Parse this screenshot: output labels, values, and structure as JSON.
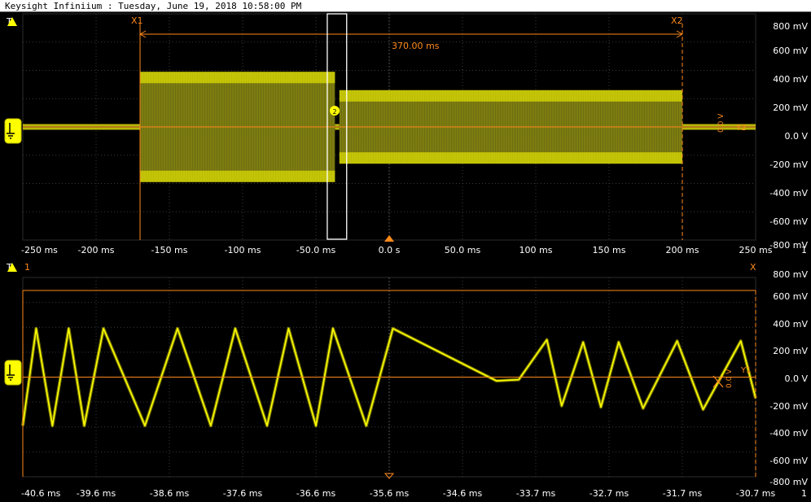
{
  "window": {
    "title": "Keysight Infiniium : Tuesday, June 19, 2018 10:58:00 PM"
  },
  "colors": {
    "trace": "#ffff00",
    "marker": "#ff8a1a",
    "grid": "#3a3a3a",
    "axis_text": "#ffffff",
    "background": "#000000"
  },
  "upper_panel": {
    "corner_label": "T",
    "marker_x1_label": "X1",
    "marker_x2_label": "X2",
    "delta_label": "370.00 ms",
    "channel_badge": "2",
    "y2_label": "Y2",
    "y_marker_value": "0.0 V",
    "y_tick_labels": [
      "800 mV",
      "600 mV",
      "400 mV",
      "200 mV",
      "0.0 V",
      "-200 mV",
      "-400 mV",
      "-600 mV",
      "-800 mV"
    ],
    "x_tick_labels": [
      "-250 ms",
      "-200 ms",
      "-150 ms",
      "-100 ms",
      "-50.0 ms",
      "0.0 s",
      "50.0 ms",
      "100 ms",
      "150 ms",
      "200 ms",
      "250 ms"
    ],
    "page_indicator": "1",
    "channel_icon": "ground-reference-icon",
    "trigger_icon": "trigger-arrow-icon"
  },
  "lower_panel": {
    "corner_label": "T",
    "marker_x1_label": "1",
    "marker_x_label": "X",
    "y1_label": "Y1",
    "y_marker_value": "0.0 V",
    "y_tick_labels": [
      "800 mV",
      "600 mV",
      "400 mV",
      "200 mV",
      "0.0 V",
      "-200 mV",
      "-400 mV",
      "-600 mV",
      "-800 mV"
    ],
    "x_tick_labels": [
      "-40.6 ms",
      "-39.6 ms",
      "-38.6 ms",
      "-37.6 ms",
      "-36.6 ms",
      "-35.6 ms",
      "-34.6 ms",
      "-33.7 ms",
      "-32.7 ms",
      "-31.7 ms",
      "-30.7 ms"
    ],
    "page_indicator": "1",
    "channel_icon": "ground-reference-icon",
    "trigger_icon": "trigger-arrow-icon"
  },
  "chart_data": [
    {
      "type": "line",
      "title": "",
      "xlabel": "",
      "ylabel": "",
      "x_range_ms": [
        -250,
        250
      ],
      "ylim_mV": [
        -800,
        800
      ],
      "grid": true,
      "cursor_x1_ms": -170,
      "cursor_x2_ms": 200,
      "cursor_delta_ms": 370,
      "zoom_window_ms": [
        -40.6,
        -30.7
      ],
      "series": [
        {
          "segments": [
            {
              "x_start_ms": -250,
              "x_end_ms": -170,
              "amplitude_mV": 20
            },
            {
              "x_start_ms": -170,
              "x_end_ms": -37,
              "amplitude_mV": 390
            },
            {
              "x_start_ms": -37,
              "x_end_ms": -34,
              "amplitude_mV": 20
            },
            {
              "x_start_ms": -34,
              "x_end_ms": 200,
              "amplitude_mV": 260
            },
            {
              "x_start_ms": 200,
              "x_end_ms": 250,
              "amplitude_mV": 20
            }
          ]
        }
      ]
    },
    {
      "type": "line",
      "title": "",
      "xlabel": "",
      "ylabel": "",
      "x_range_ms": [
        -40.6,
        -30.7
      ],
      "ylim_mV": [
        -800,
        800
      ],
      "grid": true,
      "series": [
        {
          "x": [
            -40.6,
            -40.42,
            -40.2,
            -39.98,
            -39.77,
            -39.51,
            -38.95,
            -38.51,
            -38.06,
            -37.73,
            -37.3,
            -37.01,
            -36.64,
            -36.41,
            -35.96,
            -35.6,
            -34.2,
            -33.9,
            -33.52,
            -33.32,
            -33.03,
            -32.79,
            -32.55,
            -32.22,
            -31.76,
            -31.41,
            -30.9,
            -30.7
          ],
          "y": [
            -390,
            390,
            -390,
            390,
            -390,
            390,
            -390,
            390,
            -390,
            390,
            -390,
            390,
            -390,
            390,
            -390,
            390,
            -30,
            -20,
            300,
            -230,
            280,
            -240,
            280,
            -250,
            290,
            -260,
            290,
            -170
          ]
        }
      ]
    }
  ]
}
